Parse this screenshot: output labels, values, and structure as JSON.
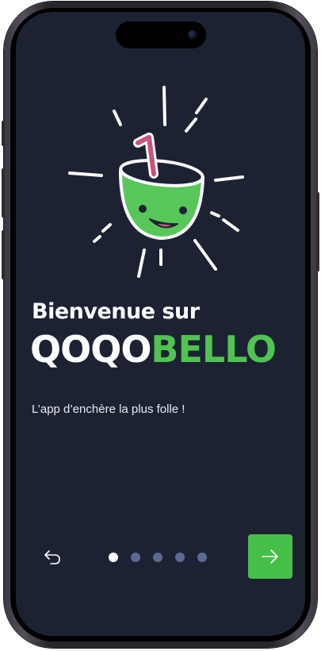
{
  "onboarding": {
    "welcome_line": "Bienvenue sur",
    "brand_part1": "QOQO",
    "brand_part2": "BELLO",
    "tagline": "L’app d’enchère la plus folle !",
    "page_indicator": {
      "total": 5,
      "current": 1
    }
  },
  "icons": {
    "back": "undo-arrow-icon",
    "next": "arrow-right-icon",
    "logo": "coconut-mascot-logo"
  },
  "colors": {
    "background": "#1d2233",
    "brand_green": "#4fc450",
    "next_button": "#46bf48",
    "dot_inactive": "#5c6a90",
    "dot_active": "#ffffff",
    "straw": "#c9527f"
  }
}
